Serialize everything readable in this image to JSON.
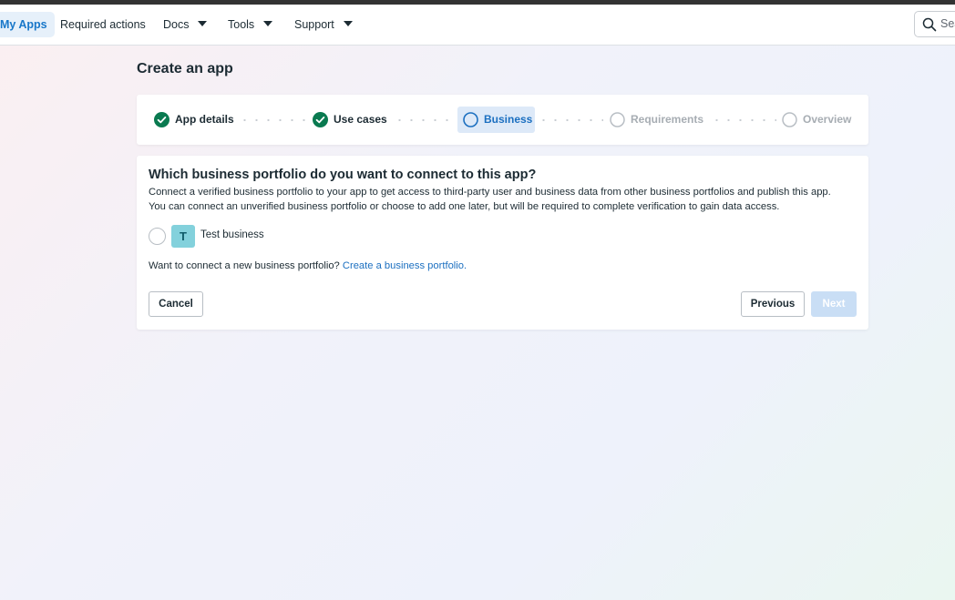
{
  "nav": {
    "my_apps": "My Apps",
    "required_actions": "Required actions",
    "docs": "Docs",
    "tools": "Tools",
    "support": "Support",
    "search_placeholder": "Sea"
  },
  "page": {
    "title": "Create an app"
  },
  "stepper": {
    "steps": [
      {
        "label": "App details",
        "state": "complete"
      },
      {
        "label": "Use cases",
        "state": "complete"
      },
      {
        "label": "Business",
        "state": "current"
      },
      {
        "label": "Requirements",
        "state": "upcoming"
      },
      {
        "label": "Overview",
        "state": "upcoming"
      }
    ]
  },
  "business": {
    "question": "Which business portfolio do you want to connect to this app?",
    "description_line1": "Connect a verified business portfolio to your app to get access to third-party user and business data from other business portfolios and publish this app.",
    "description_line2": "You can connect an unverified business portfolio or choose to add one later, but will be required to complete verification to gain data access.",
    "option_avatar": "T",
    "option_name": "Test business",
    "connect_prompt": "Want to connect a new business portfolio?",
    "connect_link": "Create a business portfolio."
  },
  "buttons": {
    "cancel": "Cancel",
    "previous": "Previous",
    "next": "Next"
  },
  "colors": {
    "accent": "#1b6fc0",
    "complete": "#0a7a50",
    "avatar": "#83d1dc"
  }
}
